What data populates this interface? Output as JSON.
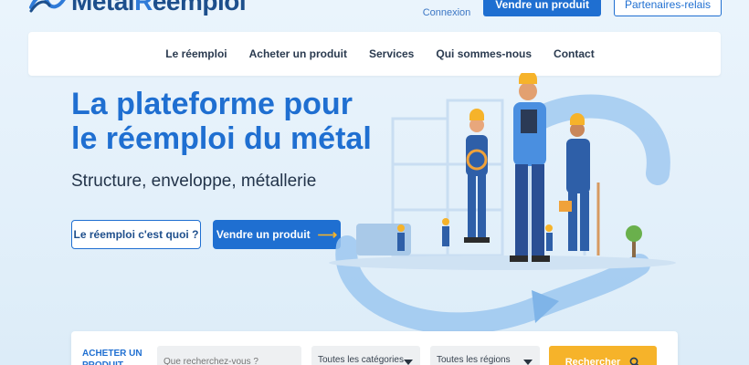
{
  "header": {
    "logo_text_left": "Metal",
    "logo_text_r": "R",
    "logo_text_right": "eemploi",
    "connexion": "Connexion",
    "sell_button": "Vendre un produit",
    "partners_button": "Partenaires-relais"
  },
  "nav": {
    "items": [
      "Le réemploi",
      "Acheter un produit",
      "Services",
      "Qui sommes-nous",
      "Contact"
    ]
  },
  "hero": {
    "title": "La plateforme pour le réemploi du métal",
    "subtitle": "Structure, enveloppe, métallerie",
    "cta_secondary": "Le réemploi c'est quoi ?",
    "cta_primary": "Vendre un produit",
    "cta_primary_icon": "arrow-right-icon"
  },
  "search": {
    "label": "ACHETER UN PRODUIT",
    "placeholder": "Que recherchez-vous ?",
    "category": "Toutes les catégories",
    "region": "Toutes les régions",
    "button": "Rechercher",
    "button_icon": "search-icon"
  },
  "colors": {
    "primary": "#1f6fd1",
    "accent": "#f6b32a",
    "background": "#e6f2fb"
  }
}
